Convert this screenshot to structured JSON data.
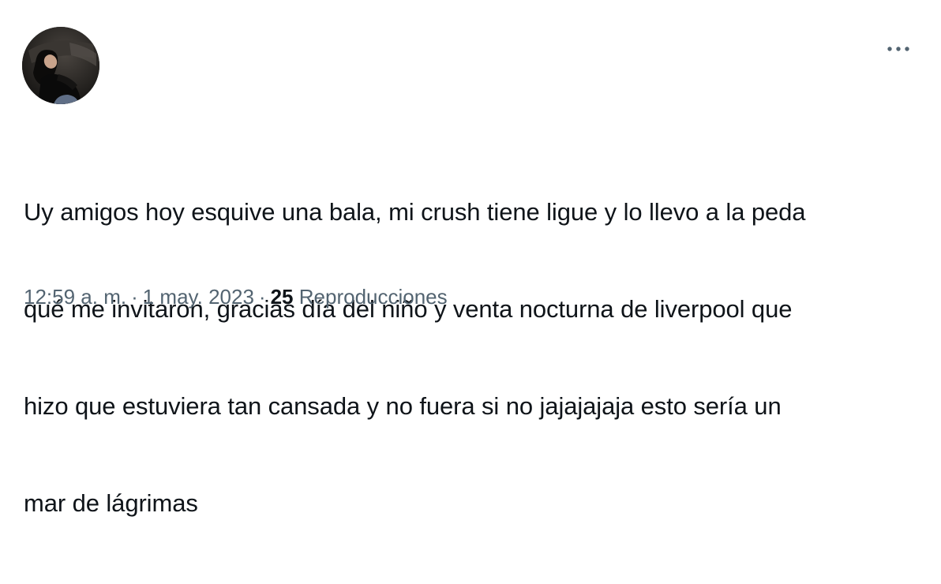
{
  "tweet": {
    "avatar": {
      "icon": "profile-photo",
      "alt": ""
    },
    "more_icon": "more-horizontal-icon",
    "text_lines": [
      "Uy amigos hoy esquive una bala, mi crush tiene ligue y lo llevo a la peda",
      "qué me invitaron, gracias día del niño y venta nocturna de liverpool que",
      "hizo que estuviera tan cansada y no fuera si no jajajajaja esto sería un",
      "mar de lágrimas"
    ],
    "time": "12:59 a. m.",
    "separator": "·",
    "date": "1 may. 2023",
    "views_count": "25",
    "views_label": "Reproducciones"
  },
  "colors": {
    "text": "#0f1419",
    "secondary": "#536471",
    "background": "#ffffff"
  }
}
